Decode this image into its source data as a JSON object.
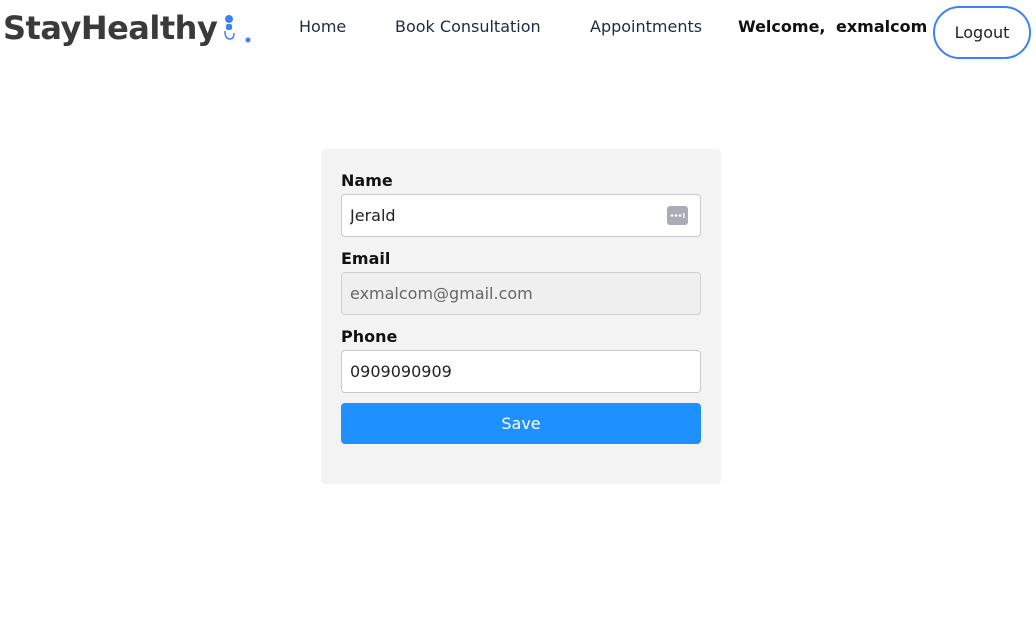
{
  "brand": {
    "name": "StayHealthy",
    "accent": "#3b82f6"
  },
  "nav": {
    "home": "Home",
    "book": "Book Consultation",
    "appointments": "Appointments",
    "welcome_label": "Welcome,",
    "username": "exmalcom",
    "logout": "Logout"
  },
  "form": {
    "name": {
      "label": "Name",
      "value": "Jerald",
      "autofill_icon": "password-manager-icon"
    },
    "email": {
      "label": "Email",
      "value": "exmalcom@gmail.com",
      "disabled": true
    },
    "phone": {
      "label": "Phone",
      "value": "0909090909"
    },
    "save_label": "Save",
    "save_color": "#1e90ff"
  }
}
